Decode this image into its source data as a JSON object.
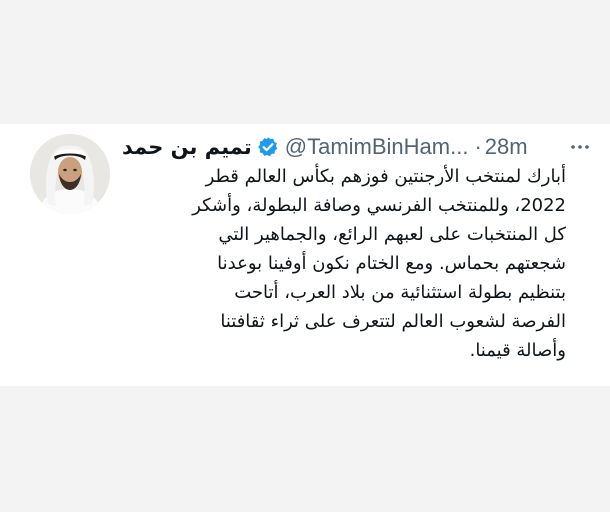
{
  "tweet": {
    "display_name": "تميم بن حمد",
    "verified_icon": "verified-badge-icon",
    "handle": "@TamimBinHam...",
    "time_separator": "·",
    "timestamp": "28m",
    "more_icon": "more-options-icon",
    "avatar_icon": "profile-avatar",
    "text_lines": [
      "أبارك لمنتخب الأرجنتين فوزهم بكأس العالم قطر",
      "2022، وللمنتخب الفرنسي وصافة البطولة، وأشكر",
      "كل المنتخبات على لعبهم الرائع، والجماهير التي",
      "شجعتهم بحماس. ومع الختام نكون أوفينا بوعدنا",
      "بتنظيم بطولة استثنائية من بلاد العرب، أتاحت",
      "الفرصة لشعوب العالم لتتعرف على ثراء ثقافتنا",
      "وأصالة قيمنا."
    ]
  },
  "colors": {
    "background": "#f3f3f3",
    "card": "#ffffff",
    "text_primary": "#0f1419",
    "text_secondary": "#536471",
    "verified_blue": "#1d9bf0"
  }
}
